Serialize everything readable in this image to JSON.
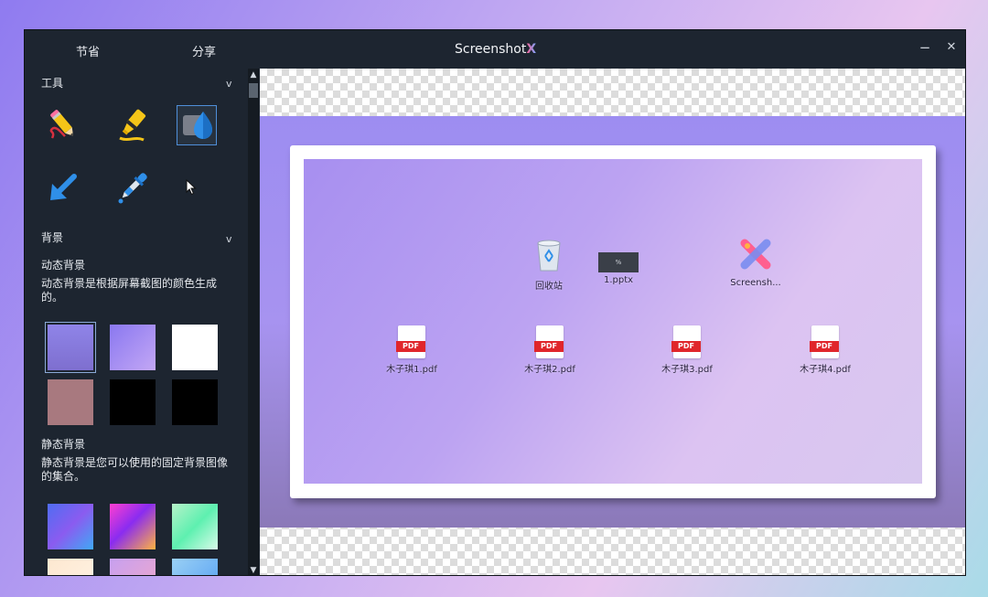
{
  "titlebar": {
    "tab_save": "节省",
    "tab_share": "分享",
    "app_title": "Screenshot",
    "app_title_mark": "X",
    "minimize": "−",
    "close": "✕"
  },
  "sidebar": {
    "tools_title": "工具",
    "tools_chevron": "v",
    "tools": [
      {
        "name": "pencil",
        "label": ""
      },
      {
        "name": "highlighter",
        "label": ""
      },
      {
        "name": "blur-drop",
        "label": ""
      },
      {
        "name": "arrow",
        "label": ""
      },
      {
        "name": "eyedropper",
        "label": ""
      }
    ],
    "background_title": "背景",
    "background_chevron": "v",
    "dynamic_title": "动态背景",
    "dynamic_desc": "动态背景是根据屏幕截图的颜色生成的。",
    "dynamic_swatches": [
      {
        "color": "#8b7fe6",
        "selected": true
      },
      {
        "color": "#a58ff2",
        "selected": false
      },
      {
        "color": "#ffffff",
        "selected": false
      },
      {
        "color": "#a8797f",
        "selected": false
      },
      {
        "color": "#000000",
        "selected": false
      },
      {
        "color": "#000000",
        "selected": false
      }
    ],
    "static_title": "静态背景",
    "static_desc": "静态背景是您可以使用的固定背景图像的集合。"
  },
  "desktop": {
    "icons": [
      {
        "label": "回收站",
        "type": "recycle-bin"
      },
      {
        "label": "1.pptx",
        "type": "pptx"
      },
      {
        "label": "Screensh...",
        "type": "screenshotx"
      },
      {
        "label": "木子琪1.pdf",
        "type": "pdf"
      },
      {
        "label": "木子琪2.pdf",
        "type": "pdf"
      },
      {
        "label": "木子琪3.pdf",
        "type": "pdf"
      },
      {
        "label": "木子琪4.pdf",
        "type": "pdf"
      }
    ],
    "pdf_tag": "PDF",
    "pptx_thumb": "%"
  }
}
